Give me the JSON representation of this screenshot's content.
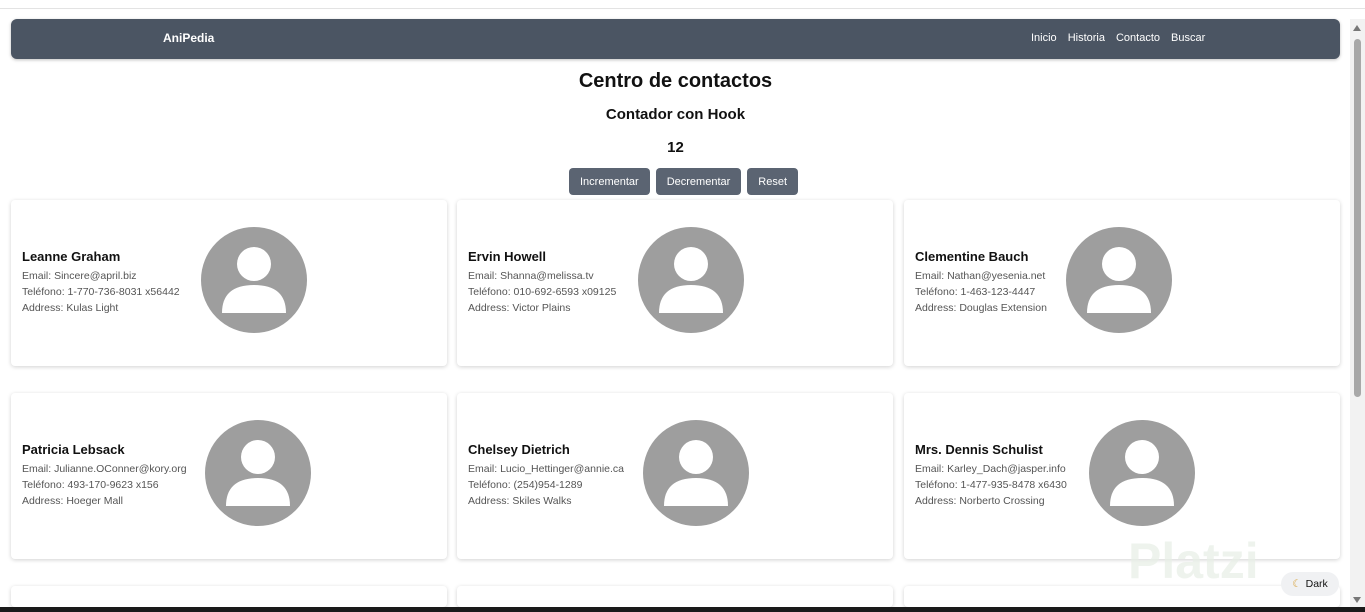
{
  "nav": {
    "brand": "AniPedia",
    "links": [
      "Inicio",
      "Historia",
      "Contacto",
      "Buscar"
    ]
  },
  "page": {
    "title": "Centro de contactos",
    "counter_title": "Contador con Hook",
    "counter_value": "12"
  },
  "buttons": {
    "increment": "Incrementar",
    "decrement": "Decrementar",
    "reset": "Reset"
  },
  "contacts": [
    {
      "name": "Leanne Graham",
      "email": "Email: Sincere@april.biz",
      "phone": "Teléfono: 1-770-736-8031 x56442",
      "address": "Address: Kulas Light"
    },
    {
      "name": "Ervin Howell",
      "email": "Email: Shanna@melissa.tv",
      "phone": "Teléfono: 010-692-6593 x09125",
      "address": "Address: Victor Plains"
    },
    {
      "name": "Clementine Bauch",
      "email": "Email: Nathan@yesenia.net",
      "phone": "Teléfono: 1-463-123-4447",
      "address": "Address: Douglas Extension"
    },
    {
      "name": "Patricia Lebsack",
      "email": "Email: Julianne.OConner@kory.org",
      "phone": "Teléfono: 493-170-9623 x156",
      "address": "Address: Hoeger Mall"
    },
    {
      "name": "Chelsey Dietrich",
      "email": "Email: Lucio_Hettinger@annie.ca",
      "phone": "Teléfono: (254)954-1289",
      "address": "Address: Skiles Walks"
    },
    {
      "name": "Mrs. Dennis Schulist",
      "email": "Email: Karley_Dach@jasper.info",
      "phone": "Teléfono: 1-477-935-8478 x6430",
      "address": "Address: Norberto Crossing"
    }
  ],
  "theme_toggle": {
    "label": "Dark",
    "icon": "moon-icon"
  },
  "watermark": "Platzi",
  "colors": {
    "navbar": "#4b5563",
    "button": "#5b6472",
    "avatar": "#9e9e9e"
  }
}
